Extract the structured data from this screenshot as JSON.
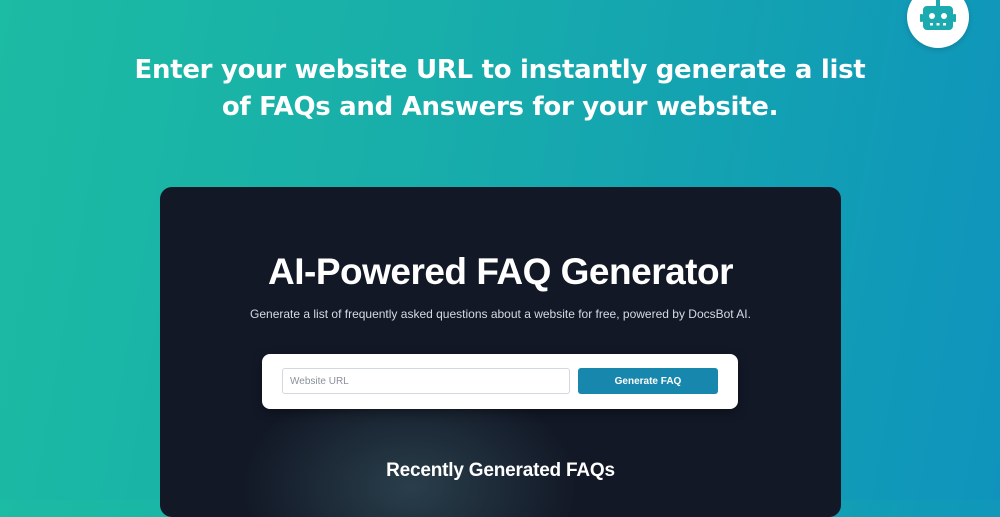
{
  "headline": {
    "line1": "Enter your website URL to instantly generate a list",
    "line2": "of FAQs and Answers for your website."
  },
  "avatar": {
    "icon": "robot-icon"
  },
  "card": {
    "title": "AI-Powered FAQ Generator",
    "subtitle": "Generate a list of frequently asked questions about a website for free, powered by DocsBot AI.",
    "form": {
      "url_placeholder": "Website URL",
      "url_value": "",
      "button_label": "Generate FAQ"
    },
    "recent_heading": "Recently Generated FAQs"
  },
  "colors": {
    "background_start": "#1cbba3",
    "background_end": "#0f93bd",
    "card_background": "#121826",
    "button": "#1787ad",
    "robot_icon": "#1aaab0"
  }
}
